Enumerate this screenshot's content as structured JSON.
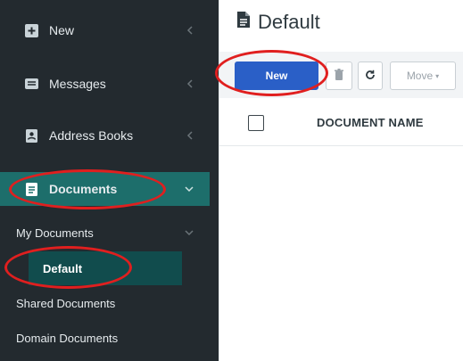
{
  "sidebar": {
    "items": [
      {
        "label": "New",
        "icon": "compose-icon"
      },
      {
        "label": "Messages",
        "icon": "messages-icon"
      },
      {
        "label": "Address Books",
        "icon": "address-book-icon"
      },
      {
        "label": "Documents",
        "icon": "document-icon"
      }
    ],
    "subitems": [
      {
        "label": "My Documents"
      },
      {
        "label": "Default"
      },
      {
        "label": "Shared Documents"
      },
      {
        "label": "Domain Documents"
      }
    ]
  },
  "header": {
    "title": "Default",
    "icon": "document-icon"
  },
  "toolbar": {
    "new_label": "New",
    "move_label": "Move"
  },
  "table": {
    "columns": [
      "DOCUMENT NAME"
    ]
  },
  "colors": {
    "sidebar_bg": "#232a2f",
    "active_bg": "#1d6e6b",
    "selected_bg": "#114c4d",
    "primary_button": "#2a5fc7",
    "annotation": "#e01f1f"
  }
}
